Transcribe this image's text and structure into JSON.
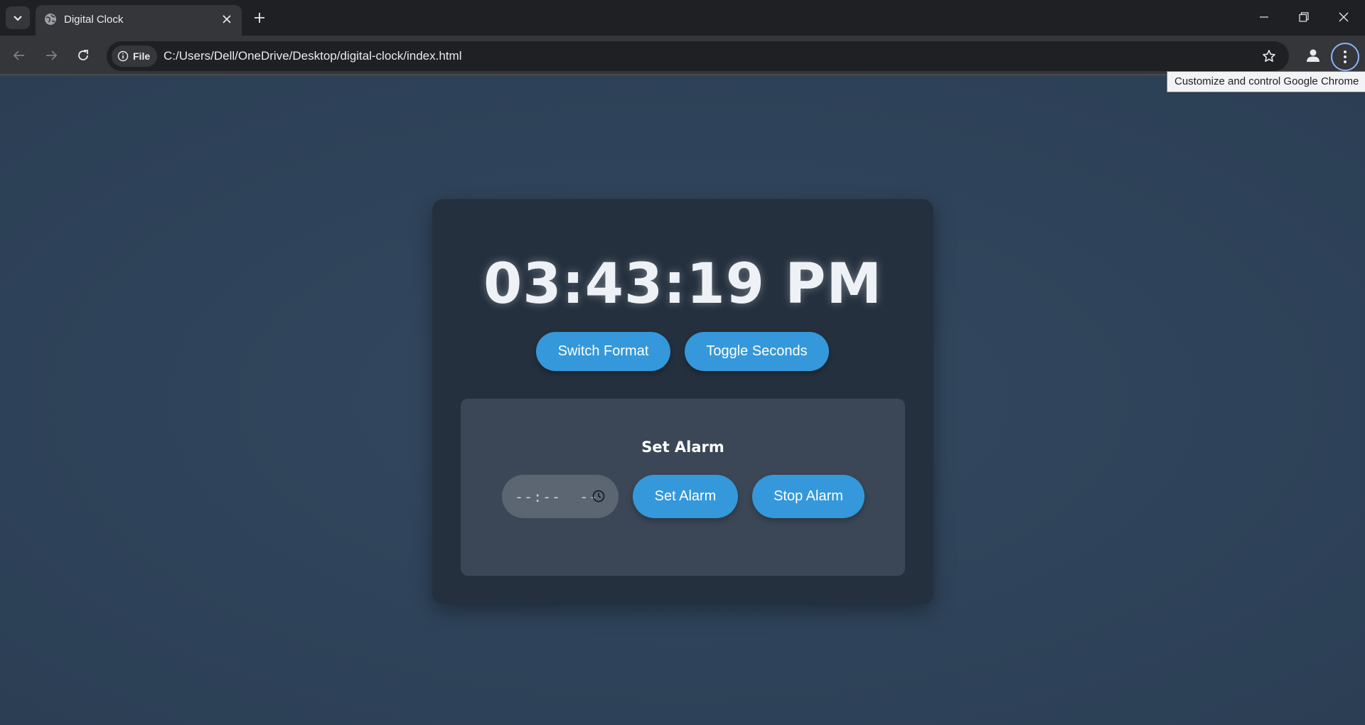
{
  "browser": {
    "tab_title": "Digital Clock",
    "omnibox": {
      "chip_label": "File",
      "url": "C:/Users/Dell/OneDrive/Desktop/digital-clock/index.html"
    },
    "tooltip": "Customize and control Google Chrome",
    "icons": [
      "tab-search-icon",
      "globe-icon",
      "close-icon",
      "plus-icon",
      "minimize-icon",
      "restore-icon",
      "window-close-icon",
      "back-arrow-icon",
      "forward-arrow-icon",
      "reload-icon",
      "info-icon",
      "star-icon",
      "profile-icon",
      "kebab-menu-icon"
    ]
  },
  "clock": {
    "time": "03:43:19 PM",
    "switch_format_label": "Switch Format",
    "toggle_seconds_label": "Toggle Seconds"
  },
  "alarm": {
    "title": "Set Alarm",
    "time_input_value": "--:--  --",
    "set_label": "Set Alarm",
    "stop_label": "Stop Alarm"
  },
  "colors": {
    "page_background": "#2f4259",
    "card_background": "#24303e",
    "panel_background": "#3b4756",
    "button": "#3498db",
    "input_background": "#5b6672"
  }
}
